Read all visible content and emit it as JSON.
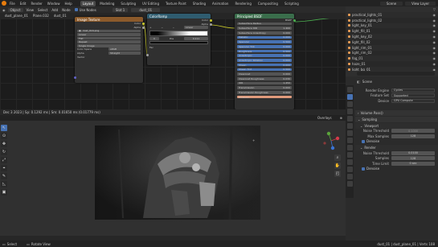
{
  "topbar": {
    "menus": [
      "File",
      "Edit",
      "Render",
      "Window",
      "Help"
    ],
    "workspaces": [
      "Layout",
      "Modeling",
      "Sculpting",
      "UV Editing",
      "Texture Paint",
      "Shading",
      "Animation",
      "Rendering",
      "Compositing",
      "Scripting"
    ],
    "active_workspace": "Layout",
    "scene_label": "Scene",
    "view_layer_label": "View Layer"
  },
  "node_editor": {
    "object_mode": "Object",
    "menus": [
      "View",
      "Select",
      "Add",
      "Node"
    ],
    "use_nodes_label": "Use Nodes",
    "slot_label": "Slot 1",
    "material_name": "dust_01",
    "breadcrumb": [
      "dust_plane_01",
      "Plane.032",
      "dust_01"
    ],
    "image_node": {
      "title": "Image Texture",
      "outputs": [
        "Color",
        "Alpha"
      ],
      "image_name": "dust_016.png",
      "interpolation": "Linear",
      "projection": "Flat",
      "extension": "Repeat",
      "source": "Single Image",
      "color_space_label": "Color Space",
      "color_space": "sRGB",
      "alpha_label": "Alpha",
      "alpha": "Straight",
      "vector_label": "Vector"
    },
    "ramp_node": {
      "title": "ColorRamp",
      "outputs": [
        "Color",
        "Alpha"
      ],
      "mode": "Linear",
      "pos_label": "Pos",
      "pos_value": "0.111",
      "fac_label": "Fac",
      "index": "0"
    },
    "bsdf_node": {
      "title": "Principled BSDF",
      "outputs": [
        "BSDF"
      ],
      "rows": [
        {
          "label": "Subsurface Radius",
          "value": ""
        },
        {
          "label": "Subsurface IOR",
          "value": "1.400"
        },
        {
          "label": "Subsurface Anisotropy",
          "value": "0.000"
        },
        {
          "label": "Metallic",
          "value": "0.000"
        },
        {
          "label": "Specular",
          "value": "0.500"
        },
        {
          "label": "Specular Tint",
          "value": "0.000"
        },
        {
          "label": "Roughness",
          "value": "0.500"
        },
        {
          "label": "Anisotropic",
          "value": "0.000"
        },
        {
          "label": "Anisotropic Rotation",
          "value": "0.000"
        },
        {
          "label": "Sheen",
          "value": "0.000"
        },
        {
          "label": "Sheen Tint",
          "value": "0.500"
        },
        {
          "label": "Clearcoat",
          "value": "0.000"
        },
        {
          "label": "Clearcoat Roughness",
          "value": "0.030"
        },
        {
          "label": "IOR",
          "value": "1.450"
        },
        {
          "label": "Transmission",
          "value": "0.000"
        },
        {
          "label": "Transmission Roughness",
          "value": "0.000"
        },
        {
          "label": "Emission",
          "value": ""
        }
      ]
    }
  },
  "outliner": {
    "items": [
      {
        "name": "practical_lights_01",
        "selected": false
      },
      {
        "name": "practical_lights_02",
        "selected": false
      },
      {
        "name": "light_key_01",
        "selected": false
      },
      {
        "name": "light_fill_01",
        "selected": false
      },
      {
        "name": "light_key_02",
        "selected": false
      },
      {
        "name": "light_fill_02",
        "selected": false
      },
      {
        "name": "light_rim_01",
        "selected": false
      },
      {
        "name": "light_rim_02",
        "selected": false
      },
      {
        "name": "fog_01",
        "selected": false
      },
      {
        "name": "haze_01",
        "selected": false
      },
      {
        "name": "light_bg_01",
        "selected": false
      },
      {
        "name": "dust_plane_01",
        "selected": true
      }
    ]
  },
  "properties": {
    "scene_label": "Scene",
    "rows": [
      {
        "label": "Render Engine",
        "value": "Cycles"
      },
      {
        "label": "Feature Set",
        "value": "Supported"
      },
      {
        "label": "Device",
        "value": "GPU Compute"
      }
    ],
    "sections": {
      "volume": "Volume Pass()",
      "sampling": "Sampling",
      "viewport": "Viewport",
      "render": "Render"
    },
    "viewport_rows": [
      {
        "label": "Noise Threshold",
        "value": "0.1000"
      },
      {
        "label": "Max Samples",
        "value": "128"
      }
    ],
    "viewport_denoise": "Denoise",
    "render_rows": [
      {
        "label": "Noise Threshold",
        "value": "0.0100"
      },
      {
        "label": "Samples",
        "value": "128"
      },
      {
        "label": "Time Limit",
        "value": "0 sec"
      }
    ],
    "render_denoise": "Denoise"
  },
  "image_editor": {
    "header_text": "Dec 3 2023 | Sp: 0.1292 ms | Sm: 0.01650 ms (0.01779 ms)",
    "overlay_label": "Overlays",
    "menus": [
      "View",
      "Image",
      "Slot 1",
      "Composite"
    ]
  },
  "status": {
    "left": "Select",
    "middle": "Rotate View",
    "right": "dust_01 | dust_plane_01 | Verts 108"
  },
  "colors": {
    "accent": "#4772b3",
    "image_header": "#8b5a2b",
    "ramp_header": "#2f5c6f",
    "bsdf_header": "#3a6d4b"
  }
}
